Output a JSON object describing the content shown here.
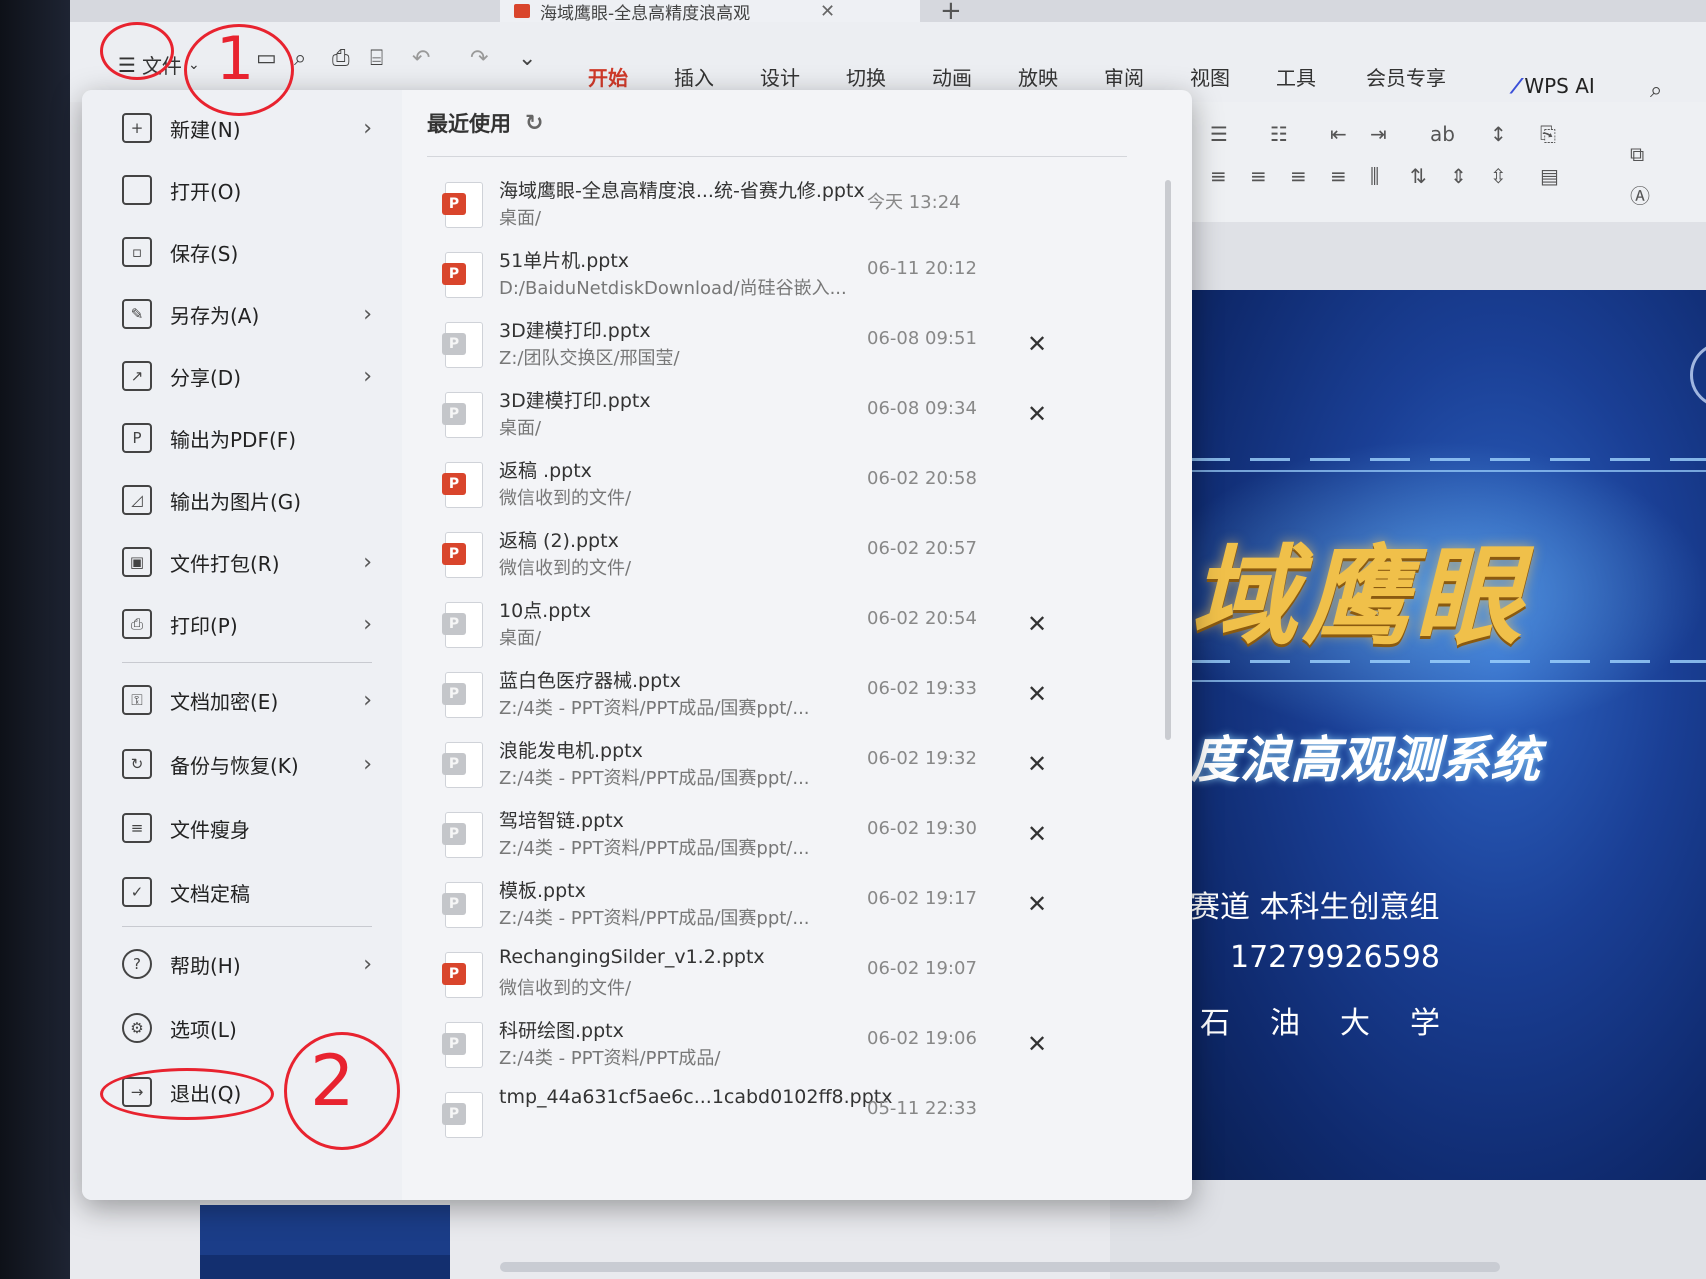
{
  "window": {
    "doc_tab_title": "海域鹰眼-全息高精度浪高观",
    "new_tab": "+"
  },
  "toolbar": {
    "menu_label": "文件",
    "ribbon_tabs": [
      "开始",
      "插入",
      "设计",
      "切换",
      "动画",
      "放映",
      "审阅",
      "视图",
      "工具",
      "会员专享"
    ],
    "active_tab": "开始",
    "wps_ai": "WPS AI"
  },
  "file_menu": {
    "items": [
      {
        "label": "新建(N)",
        "icon": "new-doc-icon",
        "arrow": true
      },
      {
        "label": "打开(O)",
        "icon": "folder-icon",
        "arrow": false
      },
      {
        "label": "保存(S)",
        "icon": "save-icon",
        "arrow": false
      },
      {
        "label": "另存为(A)",
        "icon": "save-as-icon",
        "arrow": true
      },
      {
        "label": "分享(D)",
        "icon": "share-icon",
        "arrow": true
      },
      {
        "label": "输出为PDF(F)",
        "icon": "pdf-icon",
        "arrow": false
      },
      {
        "label": "输出为图片(G)",
        "icon": "image-icon",
        "arrow": false
      },
      {
        "label": "文件打包(R)",
        "icon": "package-icon",
        "arrow": true
      },
      {
        "label": "打印(P)",
        "icon": "print-icon",
        "arrow": true
      },
      {
        "label": "文档加密(E)",
        "icon": "lock-doc-icon",
        "arrow": true
      },
      {
        "label": "备份与恢复(K)",
        "icon": "backup-icon",
        "arrow": true
      },
      {
        "label": "文件瘦身",
        "icon": "slim-icon",
        "arrow": false
      },
      {
        "label": "文档定稿",
        "icon": "finalize-icon",
        "arrow": false
      },
      {
        "label": "帮助(H)",
        "icon": "help-icon",
        "arrow": true
      },
      {
        "label": "选项(L)",
        "icon": "gear-icon",
        "arrow": false
      },
      {
        "label": "退出(Q)",
        "icon": "exit-icon",
        "arrow": false
      }
    ],
    "recent_title": "最近使用",
    "recent_files": [
      {
        "name": "海域鹰眼-全息高精度浪...统-省赛九修.pptx",
        "path": "桌面/",
        "time": "今天 13:24",
        "color": "red",
        "closable": false
      },
      {
        "name": "51单片机.pptx",
        "path": "D:/BaiduNetdiskDownload/尚硅谷嵌入...",
        "time": "06-11 20:12",
        "color": "red",
        "closable": false
      },
      {
        "name": "3D建模打印.pptx",
        "path": "Z:/团队交换区/邢国莹/",
        "time": "06-08 09:51",
        "color": "grey",
        "closable": true
      },
      {
        "name": "3D建模打印.pptx",
        "path": "桌面/",
        "time": "06-08 09:34",
        "color": "grey",
        "closable": true
      },
      {
        "name": "返稿 .pptx",
        "path": "微信收到的文件/",
        "time": "06-02 20:58",
        "color": "red",
        "closable": false
      },
      {
        "name": "返稿 (2).pptx",
        "path": "微信收到的文件/",
        "time": "06-02 20:57",
        "color": "red",
        "closable": false
      },
      {
        "name": "10点.pptx",
        "path": "桌面/",
        "time": "06-02 20:54",
        "color": "grey",
        "closable": true
      },
      {
        "name": "蓝白色医疗器械.pptx",
        "path": "Z:/4类 -     PPT资料/PPT成品/国赛ppt/...",
        "time": "06-02 19:33",
        "color": "grey",
        "closable": true
      },
      {
        "name": "浪能发电机.pptx",
        "path": "Z:/4类 -     PPT资料/PPT成品/国赛ppt/...",
        "time": "06-02 19:32",
        "color": "grey",
        "closable": true
      },
      {
        "name": "驾培智链.pptx",
        "path": "Z:/4类 -     PPT资料/PPT成品/国赛ppt/...",
        "time": "06-02 19:30",
        "color": "grey",
        "closable": true
      },
      {
        "name": "模板.pptx",
        "path": "Z:/4类 -     PPT资料/PPT成品/国赛ppt/...",
        "time": "06-02 19:17",
        "color": "grey",
        "closable": true
      },
      {
        "name": "RechangingSilder_v1.2.pptx",
        "path": "微信收到的文件/",
        "time": "06-02 19:07",
        "color": "red",
        "closable": false
      },
      {
        "name": "科研绘图.pptx",
        "path": "Z:/4类 -     PPT资料/PPT成品/",
        "time": "06-02 19:06",
        "color": "grey",
        "closable": true
      },
      {
        "name": "tmp_44a631cf5ae6c...1cabd0102ff8.pptx",
        "path": "",
        "time": "05-11 22:33",
        "color": "grey",
        "closable": false
      }
    ]
  },
  "slide": {
    "title": "域鹰眼",
    "subtitle": "度浪高观测系统",
    "line1": "赛道   本科生创意组",
    "line2": "17279926598",
    "line3": "石油大学"
  },
  "annotations": {
    "mark1": "1",
    "mark2": "2"
  },
  "colors": {
    "accent": "#d03a2a",
    "annotation": "#e8232f",
    "ppt_badge": "#d9452c"
  }
}
